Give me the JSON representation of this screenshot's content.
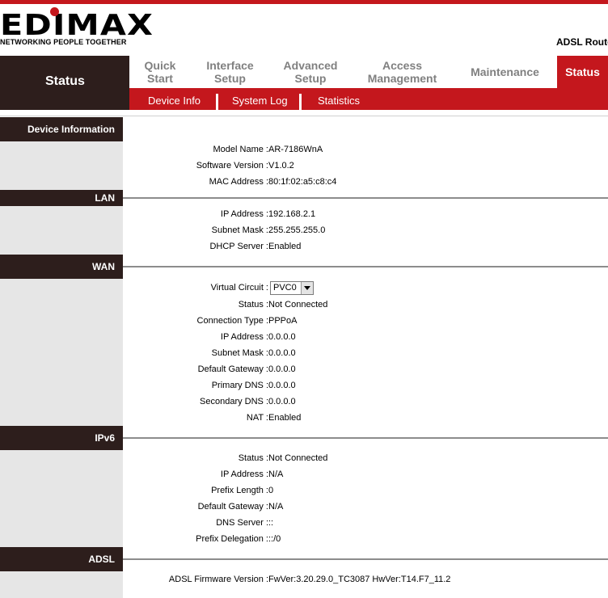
{
  "brand": {
    "logo_text": "EDIMAX",
    "tagline": "NETWORKING PEOPLE TOGETHER",
    "product": "ADSL Route"
  },
  "nav": {
    "current": "Status",
    "tabs": [
      {
        "label": "Quick\nStart",
        "active": false
      },
      {
        "label": "Interface\nSetup",
        "active": false
      },
      {
        "label": "Advanced\nSetup",
        "active": false
      },
      {
        "label": "Access\nManagement",
        "active": false
      },
      {
        "label": "Maintenance",
        "active": false
      },
      {
        "label": "Status",
        "active": true
      }
    ],
    "subtabs": [
      "Device Info",
      "System Log",
      "Statistics"
    ]
  },
  "sections": {
    "device": {
      "title": "Device Information",
      "model_label": "Model Name :",
      "model": "AR-7186WnA",
      "sw_label": "Software Version :",
      "sw": "V1.0.2",
      "mac_label": "MAC Address :",
      "mac": "80:1f:02:a5:c8:c4"
    },
    "lan": {
      "title": "LAN",
      "ip_label": "IP Address :",
      "ip": "192.168.2.1",
      "mask_label": "Subnet Mask :",
      "mask": "255.255.255.0",
      "dhcp_label": "DHCP Server :",
      "dhcp": "Enabled"
    },
    "wan": {
      "title": "WAN",
      "vc_label": "Virtual Circuit :",
      "vc": "PVC0",
      "status_label": "Status :",
      "status": "Not Connected",
      "conn_label": "Connection Type :",
      "conn": "PPPoA",
      "ip_label": "IP Address :",
      "ip": "0.0.0.0",
      "mask_label": "Subnet Mask :",
      "mask": "0.0.0.0",
      "gw_label": "Default Gateway :",
      "gw": "0.0.0.0",
      "dns1_label": "Primary DNS :",
      "dns1": "0.0.0.0",
      "dns2_label": "Secondary DNS :",
      "dns2": "0.0.0.0",
      "nat_label": "NAT :",
      "nat": "Enabled"
    },
    "ipv6": {
      "title": "IPv6",
      "status_label": "Status :",
      "status": "Not Connected",
      "ip_label": "IP Address :",
      "ip": "N/A",
      "prefix_label": "Prefix Length :",
      "prefix": "0",
      "gw_label": "Default Gateway :",
      "gw": "N/A",
      "dns_label": "DNS Server :",
      "dns": "::",
      "deleg_label": "Prefix Delegation :",
      "deleg": "::/0"
    },
    "adsl": {
      "title": "ADSL",
      "fw_label": "ADSL Firmware Version :",
      "fw": "FwVer:3.20.29.0_TC3087 HwVer:T14.F7_11.2"
    }
  },
  "colors": {
    "brand_red": "#c4171d",
    "dark_brown": "#2d1e1c",
    "side_gray": "#e6e6e6"
  }
}
